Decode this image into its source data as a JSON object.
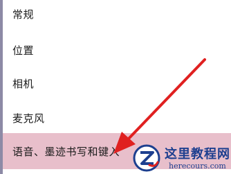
{
  "menu": {
    "items": [
      {
        "label": "常规"
      },
      {
        "label": "位置"
      },
      {
        "label": "相机"
      },
      {
        "label": "麦克风"
      },
      {
        "label": "语音、墨迹书写和键入",
        "selected": true
      }
    ]
  },
  "annotation": {
    "arrow_icon": "red-arrow-icon",
    "arrow_color": "#e02020"
  },
  "watermark": {
    "title": "这里教程网",
    "url": "herecours.com",
    "logo_icon": "z-logo-icon"
  },
  "colors": {
    "selected_background": "#e8bfcb",
    "left_border": "#8d8aa6",
    "watermark_blue": "#1d3f8f"
  }
}
